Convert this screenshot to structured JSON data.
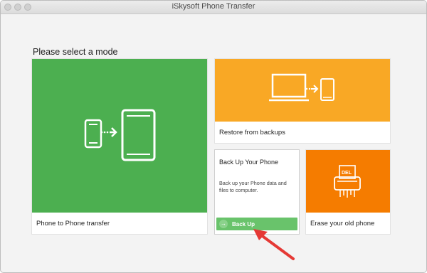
{
  "window": {
    "title": "iSkysoft Phone Transfer"
  },
  "main": {
    "heading": "Please select a mode"
  },
  "modes": {
    "phone_to_phone": {
      "label": "Phone to Phone transfer",
      "icon": "phone-to-tablet-transfer-icon"
    },
    "restore": {
      "label": "Restore from backups",
      "icon": "laptop-to-phone-icon"
    },
    "backup": {
      "title": "Back Up Your Phone",
      "description": "Back up your Phone data and files to computer.",
      "button_label": "Back Up",
      "icon": "arrow-right-circle-icon"
    },
    "erase": {
      "label": "Erase your old phone",
      "icon": "shredder-del-icon"
    }
  },
  "colors": {
    "green": "#4caf50",
    "orange": "#f9a825",
    "deep_orange": "#f57c00",
    "button_green": "#69c36b",
    "arrow_red": "#e53935"
  }
}
